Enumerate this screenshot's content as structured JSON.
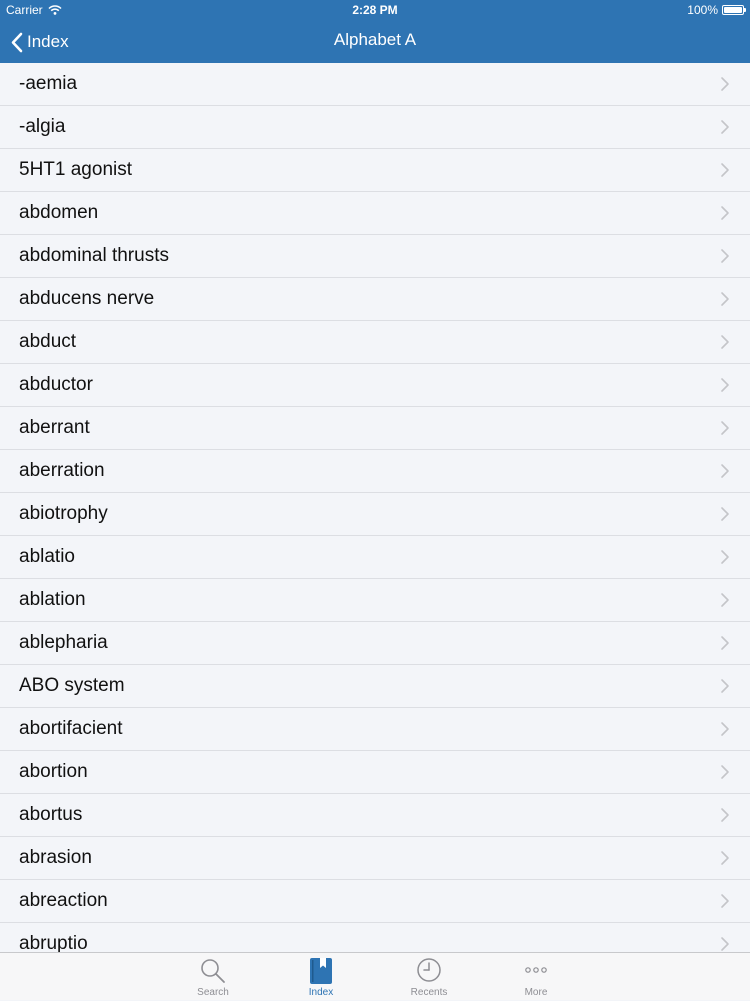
{
  "status_bar": {
    "carrier": "Carrier",
    "time": "2:28 PM",
    "battery": "100%"
  },
  "nav": {
    "back_label": "Index",
    "title": "Alphabet A"
  },
  "list": {
    "items": [
      {
        "label": "-aemia"
      },
      {
        "label": "-algia"
      },
      {
        "label": "5HT1 agonist"
      },
      {
        "label": "abdomen"
      },
      {
        "label": "abdominal thrusts"
      },
      {
        "label": "abducens nerve"
      },
      {
        "label": "abduct"
      },
      {
        "label": "abductor"
      },
      {
        "label": "aberrant"
      },
      {
        "label": "aberration"
      },
      {
        "label": "abiotrophy"
      },
      {
        "label": "ablatio"
      },
      {
        "label": "ablation"
      },
      {
        "label": "ablepharia"
      },
      {
        "label": "ABO system"
      },
      {
        "label": "abortifacient"
      },
      {
        "label": "abortion"
      },
      {
        "label": "abortus"
      },
      {
        "label": "abrasion"
      },
      {
        "label": "abreaction"
      },
      {
        "label": "abruptio"
      }
    ]
  },
  "tab_bar": {
    "tabs": [
      {
        "label": "Search",
        "icon": "search-icon",
        "active": false
      },
      {
        "label": "Index",
        "icon": "book-icon",
        "active": true
      },
      {
        "label": "Recents",
        "icon": "clock-icon",
        "active": false
      },
      {
        "label": "More",
        "icon": "more-icon",
        "active": false
      }
    ]
  },
  "colors": {
    "header_background": "#2e74b3",
    "active_tab": "#2e74b3",
    "inactive_tab": "#8e8e93",
    "list_background": "#f3f5f9"
  }
}
